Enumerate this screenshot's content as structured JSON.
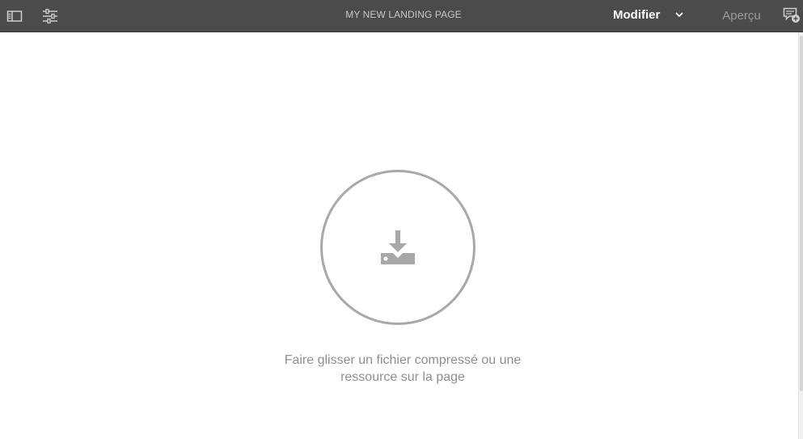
{
  "toolbar": {
    "sidepanel_icon": "sidepanel-toggle-icon",
    "properties_icon": "page-properties-icon",
    "page_title": "MY NEW LANDING PAGE",
    "mode": {
      "selected": "Modifier",
      "icon": "chevron-down-icon"
    },
    "preview_label": "Aperçu",
    "annotations_icon": "annotations-icon"
  },
  "main": {
    "dropzone_icon": "download-tray-icon",
    "dropzone_text_line1": "Faire glisser un fichier compressé ou une",
    "dropzone_text_line2": "ressource sur la page"
  },
  "colors": {
    "toolbar_bg": "#4b4b4b",
    "toolbar_text": "#c8c8c8",
    "accent_icon": "#a8a8a8",
    "body_bg": "#ffffff"
  }
}
